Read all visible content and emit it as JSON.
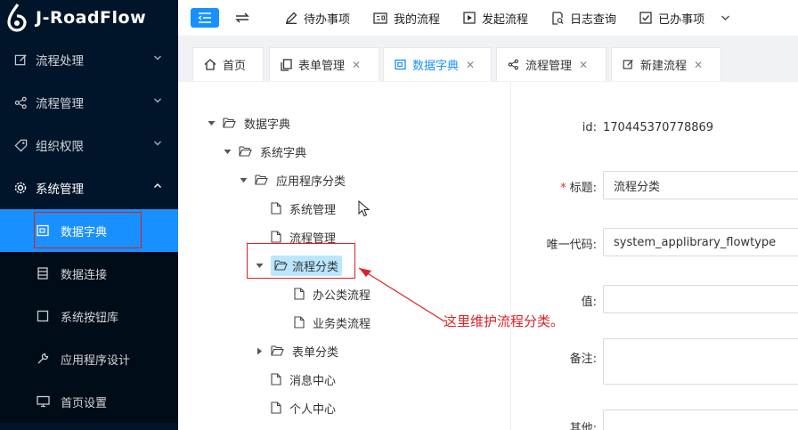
{
  "app": {
    "logo_text": "J-RoadFlow"
  },
  "sidebar": {
    "items": [
      {
        "label": "流程处理",
        "icon": "edit-icon"
      },
      {
        "label": "流程管理",
        "icon": "share-icon"
      },
      {
        "label": "组织权限",
        "icon": "tag-icon"
      },
      {
        "label": "系统管理",
        "icon": "gear-icon"
      }
    ],
    "sub_items": [
      {
        "label": "数据字典",
        "icon": "dictionary-icon",
        "active": true
      },
      {
        "label": "数据连接",
        "icon": "database-icon"
      },
      {
        "label": "系统按钮库",
        "icon": "square-icon"
      },
      {
        "label": "应用程序设计",
        "icon": "wrench-icon"
      },
      {
        "label": "首页设置",
        "icon": "monitor-icon"
      }
    ]
  },
  "topbar": {
    "links": [
      {
        "label": "待办事项",
        "icon": "pen-icon"
      },
      {
        "label": "我的流程",
        "icon": "id-card-icon"
      },
      {
        "label": "发起流程",
        "icon": "play-icon"
      },
      {
        "label": "日志查询",
        "icon": "search-doc-icon"
      },
      {
        "label": "已办事项",
        "icon": "check-square-icon"
      }
    ]
  },
  "tabs": [
    {
      "label": "首页",
      "icon": "home-icon",
      "closable": false
    },
    {
      "label": "表单管理",
      "icon": "copy-icon",
      "closable": true
    },
    {
      "label": "数据字典",
      "icon": "dictionary-icon",
      "closable": true,
      "active": true
    },
    {
      "label": "流程管理",
      "icon": "share-icon",
      "closable": true
    },
    {
      "label": "新建流程",
      "icon": "edit-icon",
      "closable": true
    }
  ],
  "tree": {
    "nodes": [
      {
        "label": "数据字典",
        "type": "folder",
        "expanded": true
      },
      {
        "label": "系统字典",
        "type": "folder",
        "expanded": true
      },
      {
        "label": "应用程序分类",
        "type": "folder",
        "expanded": true
      },
      {
        "label": "系统管理",
        "type": "file"
      },
      {
        "label": "流程管理",
        "type": "file"
      },
      {
        "label": "流程分类",
        "type": "folder",
        "expanded": true,
        "selected": true
      },
      {
        "label": "办公类流程",
        "type": "file"
      },
      {
        "label": "业务类流程",
        "type": "file"
      },
      {
        "label": "表单分类",
        "type": "folder",
        "expanded": false
      },
      {
        "label": "消息中心",
        "type": "file"
      },
      {
        "label": "个人中心",
        "type": "file"
      }
    ]
  },
  "form": {
    "id_label": "id:",
    "id_value": "170445370778869",
    "title_label": "标题:",
    "title_value": "流程分类",
    "code_label": "唯一代码:",
    "code_value": "system_applibrary_flowtype",
    "value_label": "值:",
    "value_value": "",
    "note_label": "备注:",
    "note_value": "",
    "other_label": "其他:"
  },
  "annotation": {
    "text": "这里维护流程分类。"
  },
  "colors": {
    "sidebar_bg": "#001529",
    "accent": "#1890ff",
    "annotation": "#e02020"
  }
}
